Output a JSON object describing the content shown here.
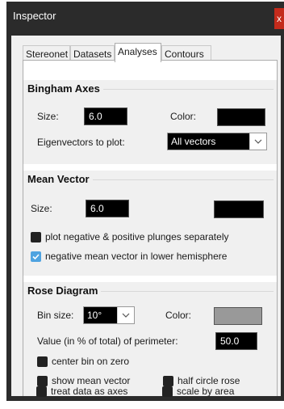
{
  "window": {
    "title": "Inspector",
    "close_label": "x"
  },
  "tabs": [
    {
      "label": "Stereonet",
      "active": false
    },
    {
      "label": "Datasets",
      "active": false
    },
    {
      "label": "Analyses",
      "active": true
    },
    {
      "label": "Contours",
      "active": false
    }
  ],
  "bingham": {
    "title": "Bingham Axes",
    "size_label": "Size:",
    "size_value": "6.0",
    "color_label": "Color:",
    "color_value": "#000000",
    "eigen_label": "Eigenvectors to plot:",
    "eigen_value": "All vectors"
  },
  "mean_vector": {
    "title": "Mean Vector",
    "size_label": "Size:",
    "size_value": "6.0",
    "color_value": "#000000",
    "plot_separately_label": "plot negative & positive plunges separately",
    "plot_separately_checked": false,
    "lower_hemisphere_label": "negative mean vector in lower hemisphere",
    "lower_hemisphere_checked": true
  },
  "rose": {
    "title": "Rose Diagram",
    "bin_size_label": "Bin size:",
    "bin_size_value": "10°",
    "color_label": "Color:",
    "color_value": "#999999",
    "perimeter_label": "Value (in % of total) of perimeter:",
    "perimeter_value": "50.0",
    "center_bin_label": "center bin on zero",
    "show_mean_label": "show mean vector",
    "half_circle_label": "half circle rose",
    "treat_axes_label": "treat data as axes",
    "scale_area_label": "scale by area"
  },
  "colors": {
    "titlebar": "#2b2b2b",
    "panel": "#f0f0f0",
    "checkbox_on": "#4fa3e0",
    "close": "#c42b1c"
  }
}
